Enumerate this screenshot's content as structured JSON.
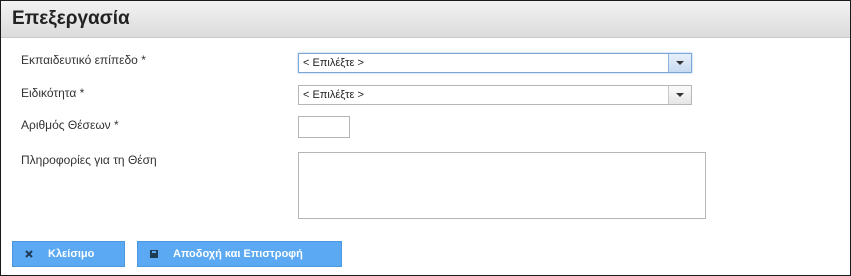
{
  "dialog": {
    "title": "Επεξεργασία"
  },
  "form": {
    "level_label": "Εκπαιδευτικό επίπεδο *",
    "level_value": "< Επιλέξτε >",
    "specialty_label": "Ειδικότητα *",
    "specialty_value": "< Επιλέξτε >",
    "positions_label": "Αριθμός Θέσεων *",
    "positions_value": "",
    "info_label": "Πληροφορίες για τη Θέση",
    "info_value": ""
  },
  "buttons": {
    "close_label": "Κλείσιμο",
    "accept_label": "Αποδοχή και Επιστροφή"
  },
  "icons": {
    "close": "close-icon",
    "save": "save-icon",
    "dropdown": "chevron-down-icon"
  },
  "colors": {
    "button_bg": "#5aa9f2",
    "button_text": "#ffffff",
    "focus_border": "#7aa7d6"
  }
}
